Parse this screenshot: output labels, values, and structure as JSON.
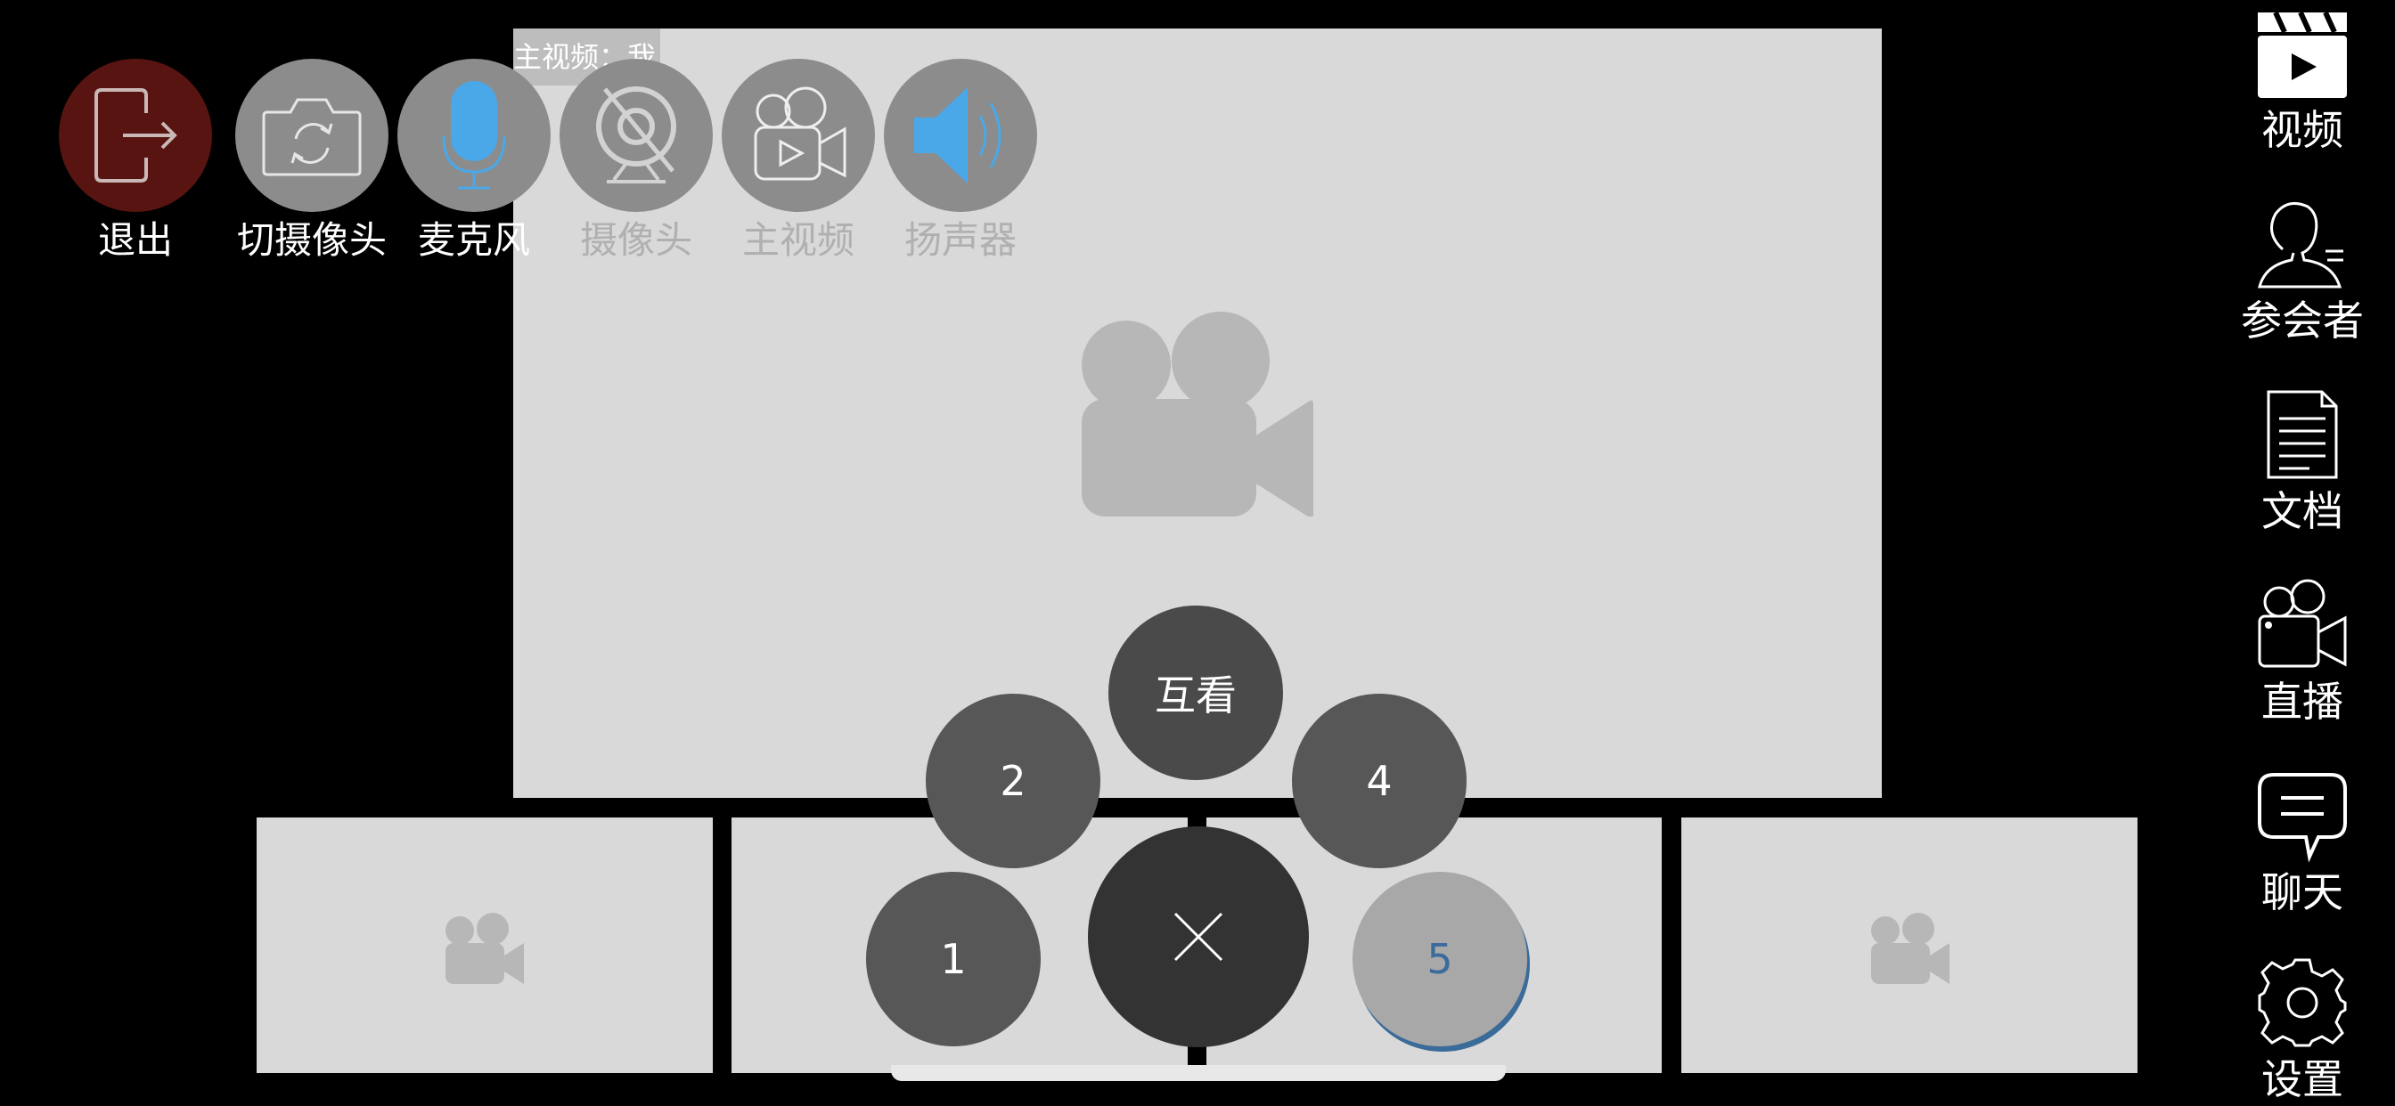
{
  "main_video": {
    "label": "主视频：我"
  },
  "toolbar": [
    {
      "id": "exit",
      "label": "退出",
      "icon": "exit-icon",
      "state": "active"
    },
    {
      "id": "switch-camera",
      "label": "切摄像头",
      "icon": "switch-camera-icon",
      "state": "active"
    },
    {
      "id": "microphone",
      "label": "麦克风",
      "icon": "microphone-icon",
      "state": "on"
    },
    {
      "id": "camera",
      "label": "摄像头",
      "icon": "camera-off-icon",
      "state": "dimmed"
    },
    {
      "id": "main-video",
      "label": "主视频",
      "icon": "main-video-icon",
      "state": "dimmed"
    },
    {
      "id": "speaker",
      "label": "扬声器",
      "icon": "speaker-icon",
      "state": "dimmed"
    }
  ],
  "layout_menu": {
    "top": "互看",
    "left": "2",
    "right": "4",
    "bottom_left": "1",
    "bottom_right": "5",
    "close_icon": "close-icon"
  },
  "sidebar": [
    {
      "label": "视频",
      "icon": "video-clapper-icon"
    },
    {
      "label": "参会者",
      "icon": "participants-icon"
    },
    {
      "label": "文档",
      "icon": "document-icon"
    },
    {
      "label": "直播",
      "icon": "live-broadcast-icon"
    },
    {
      "label": "聊天",
      "icon": "chat-icon"
    },
    {
      "label": "设置",
      "icon": "settings-gear-icon"
    }
  ],
  "colors": {
    "exit_button": "#581410",
    "tool_button": "#8c8c8c",
    "accent_blue": "#4aa8e8",
    "video_bg": "#d9d9d9",
    "camera_placeholder": "#b7b7b7"
  }
}
